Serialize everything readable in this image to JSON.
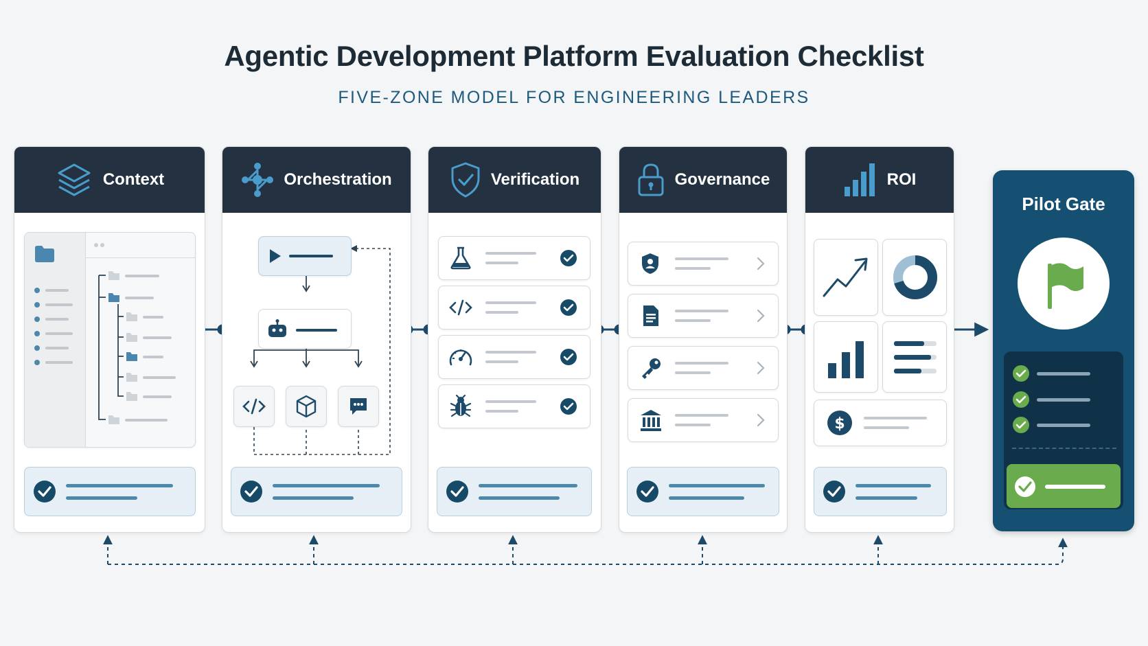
{
  "title": "Agentic Development Platform Evaluation Checklist",
  "subtitle": "FIVE-ZONE MODEL FOR ENGINEERING LEADERS",
  "zones": [
    {
      "label": "Context",
      "icon": "layers-icon"
    },
    {
      "label": "Orchestration",
      "icon": "network-icon"
    },
    {
      "label": "Verification",
      "icon": "shield-check-icon"
    },
    {
      "label": "Governance",
      "icon": "padlock-icon"
    },
    {
      "label": "ROI",
      "icon": "bar-chart-icon"
    }
  ],
  "pilot_gate": {
    "label": "Pilot Gate",
    "icon": "flag-icon"
  },
  "colors": {
    "header": "#233140",
    "accent": "#1e5a7e",
    "gate": "#155072",
    "green": "#6aab4e",
    "check": "#174a67"
  }
}
